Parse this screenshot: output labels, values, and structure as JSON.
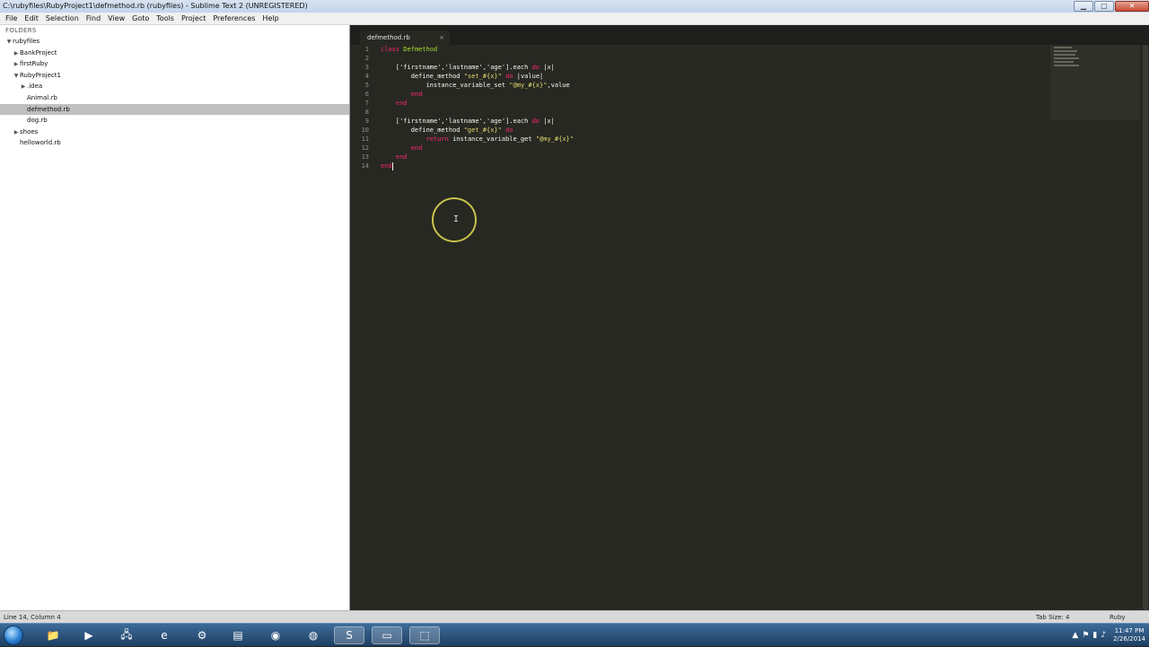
{
  "window": {
    "title": "C:\\rubyfiles\\RubyProject1\\defmethod.rb (rubyfiles) - Sublime Text 2 (UNREGISTERED)",
    "minimize_icon": "minimize-icon",
    "maximize_icon": "maximize-icon",
    "close_icon": "close-icon"
  },
  "menu": {
    "items": [
      "File",
      "Edit",
      "Selection",
      "Find",
      "View",
      "Goto",
      "Tools",
      "Project",
      "Preferences",
      "Help"
    ]
  },
  "sidebar": {
    "header": "FOLDERS",
    "rows": [
      {
        "label": "rubyfiles",
        "indent": 0,
        "toggle": "open",
        "selected": false
      },
      {
        "label": "BankProject",
        "indent": 1,
        "toggle": "closed",
        "selected": false
      },
      {
        "label": "firstRuby",
        "indent": 1,
        "toggle": "closed",
        "selected": false
      },
      {
        "label": "RubyProject1",
        "indent": 1,
        "toggle": "open",
        "selected": false
      },
      {
        "label": ".idea",
        "indent": 2,
        "toggle": "closed",
        "selected": false
      },
      {
        "label": "Animal.rb",
        "indent": 2,
        "toggle": "none",
        "selected": false
      },
      {
        "label": "defmethod.rb",
        "indent": 2,
        "toggle": "none",
        "selected": true
      },
      {
        "label": "dog.rb",
        "indent": 2,
        "toggle": "none",
        "selected": false
      },
      {
        "label": "shoes",
        "indent": 1,
        "toggle": "closed",
        "selected": false
      },
      {
        "label": "helloworld.rb",
        "indent": 1,
        "toggle": "none",
        "selected": false
      }
    ]
  },
  "editor": {
    "tab": {
      "label": "defmethod.rb",
      "close": "×"
    },
    "line_numbers": [
      "1",
      "2",
      "3",
      "4",
      "5",
      "6",
      "7",
      "8",
      "9",
      "10",
      "11",
      "12",
      "13",
      "14"
    ],
    "lines": [
      [
        {
          "t": "class ",
          "c": "kw"
        },
        {
          "t": "Defmethod",
          "c": "cls"
        }
      ],
      [],
      [
        {
          "t": "    ['firstname','lastname','age'].each ",
          "c": ""
        },
        {
          "t": "do",
          "c": "kw"
        },
        {
          "t": " |x|",
          "c": ""
        }
      ],
      [
        {
          "t": "        define_method ",
          "c": ""
        },
        {
          "t": "\"set_#{x}\"",
          "c": "str"
        },
        {
          "t": " ",
          "c": ""
        },
        {
          "t": "do",
          "c": "kw"
        },
        {
          "t": " |value|",
          "c": ""
        }
      ],
      [
        {
          "t": "            instance_variable_set ",
          "c": ""
        },
        {
          "t": "\"@my_#{x}\"",
          "c": "str"
        },
        {
          "t": ",value",
          "c": ""
        }
      ],
      [
        {
          "t": "        end",
          "c": "kw"
        }
      ],
      [
        {
          "t": "    end",
          "c": "kw"
        }
      ],
      [],
      [
        {
          "t": "    ['firstname','lastname','age'].each ",
          "c": ""
        },
        {
          "t": "do",
          "c": "kw"
        },
        {
          "t": " |x|",
          "c": ""
        }
      ],
      [
        {
          "t": "        define_method ",
          "c": ""
        },
        {
          "t": "\"get_#{x}\"",
          "c": "str"
        },
        {
          "t": " ",
          "c": ""
        },
        {
          "t": "do",
          "c": "kw"
        }
      ],
      [
        {
          "t": "            ",
          "c": ""
        },
        {
          "t": "return",
          "c": "kw"
        },
        {
          "t": " instance_variable_get ",
          "c": ""
        },
        {
          "t": "\"@my_#{x}\"",
          "c": "str"
        }
      ],
      [
        {
          "t": "        end",
          "c": "kw"
        }
      ],
      [
        {
          "t": "    end",
          "c": "kw"
        }
      ],
      [
        {
          "t": "end",
          "c": "kw"
        }
      ]
    ]
  },
  "status": {
    "position": "Line 14, Column 4",
    "tab_size": "Tab Size: 4",
    "syntax": "Ruby"
  },
  "taskbar": {
    "icons": [
      "windows-start-icon",
      "explorer-icon",
      "media-player-icon",
      "network-icon",
      "internet-explorer-icon",
      "control-panel-icon",
      "notepad-icon",
      "chrome-icon",
      "firefox-icon",
      "sublime-text-icon",
      "cmd-icon",
      "snipping-tool-icon"
    ],
    "time": "11:47 PM",
    "date": "2/26/2014"
  }
}
